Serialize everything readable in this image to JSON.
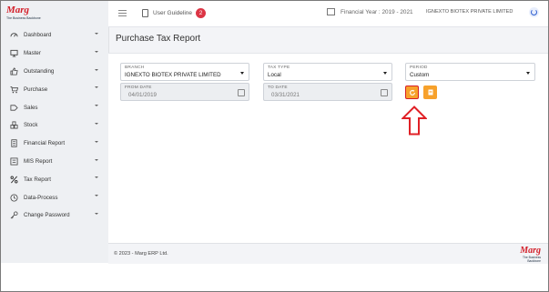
{
  "brand": {
    "logo_text": "Marg",
    "tagline": "The Business Backbone"
  },
  "header": {
    "user_guideline": "User Guideline",
    "guideline_count": "2",
    "financial_year": "Financial Year : 2019 - 2021",
    "company": "IGNEXTO BIOTEX PRIVATE LIMITED"
  },
  "sidebar": {
    "items": [
      {
        "label": "Dashboard",
        "icon": "speedometer-icon"
      },
      {
        "label": "Master",
        "icon": "monitor-icon"
      },
      {
        "label": "Outstanding",
        "icon": "thumbs-up-icon"
      },
      {
        "label": "Purchase",
        "icon": "cart-icon"
      },
      {
        "label": "Sales",
        "icon": "sales-tag-icon"
      },
      {
        "label": "Stock",
        "icon": "stock-icon"
      },
      {
        "label": "Financial Report",
        "icon": "document-icon"
      },
      {
        "label": "MIS Report",
        "icon": "list-icon"
      },
      {
        "label": "Tax Report",
        "icon": "percent-icon"
      },
      {
        "label": "Data-Process",
        "icon": "clock-icon"
      },
      {
        "label": "Change Password",
        "icon": "key-icon"
      }
    ]
  },
  "page": {
    "title": "Purchase Tax Report"
  },
  "form": {
    "branch": {
      "label": "BRANCH",
      "value": "IGNEXTO BIOTEX PRIVATE LIMITED"
    },
    "tax_type": {
      "label": "TAX TYPE",
      "value": "Local"
    },
    "period": {
      "label": "PERIOD",
      "value": "Custom"
    },
    "from_date": {
      "label": "FROM DATE",
      "value": "04/01/2019"
    },
    "to_date": {
      "label": "TO DATE",
      "value": "03/31/2021"
    }
  },
  "colors": {
    "accent": "#f7a12b",
    "highlight": "#d61f26",
    "badge": "#dc3545"
  },
  "footer": {
    "copyright": "© 2023 - Marg ERP Ltd."
  }
}
